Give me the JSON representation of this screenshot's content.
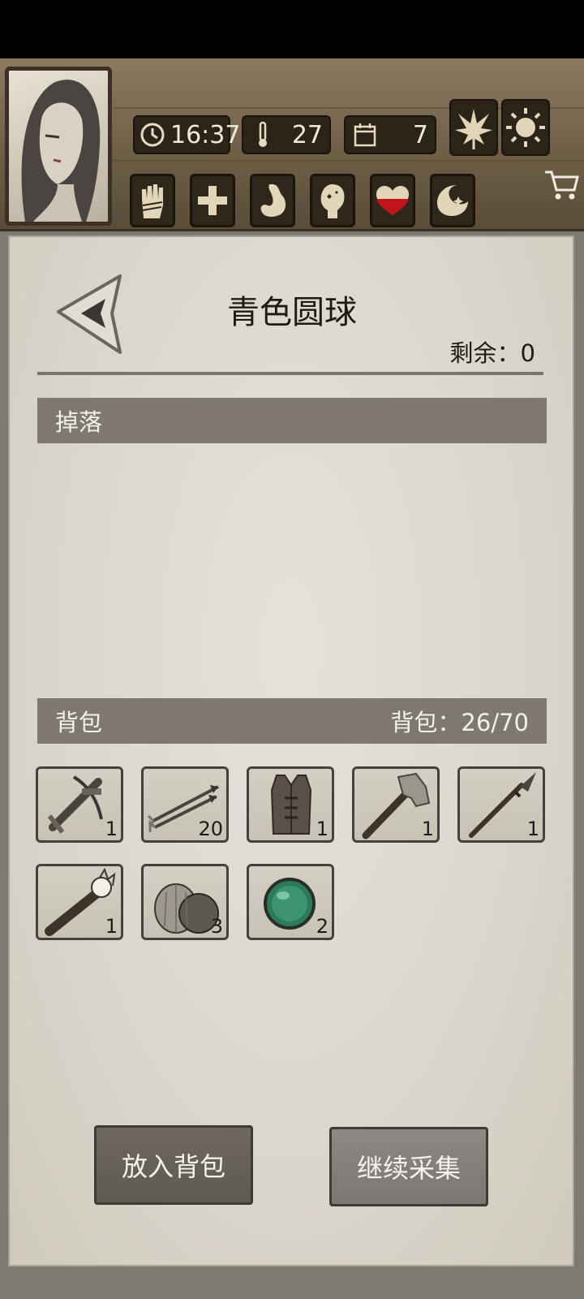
{
  "header": {
    "time": "16:37",
    "temperature": "27",
    "day": "7"
  },
  "page": {
    "title": "青色圆球",
    "remain_label": "剩余：",
    "remain_value": "0"
  },
  "drops": {
    "label": "掉落"
  },
  "backpack": {
    "label": "背包",
    "capacity_label": "背包：",
    "capacity_value": "26/70",
    "items": [
      {
        "name": "crossbow",
        "count": "1"
      },
      {
        "name": "arrows",
        "count": "20"
      },
      {
        "name": "leather-vest",
        "count": "1"
      },
      {
        "name": "axe",
        "count": "1"
      },
      {
        "name": "spear",
        "count": "1"
      },
      {
        "name": "torch",
        "count": "1"
      },
      {
        "name": "coconuts",
        "count": "3"
      },
      {
        "name": "green-orb",
        "count": "2"
      }
    ]
  },
  "actions": {
    "put_in_backpack": "放入背包",
    "continue_gathering": "继续采集"
  },
  "colors": {
    "heart": "#c0141a",
    "bar_grey": "#7f7870",
    "paper": "#dcd7cd"
  }
}
